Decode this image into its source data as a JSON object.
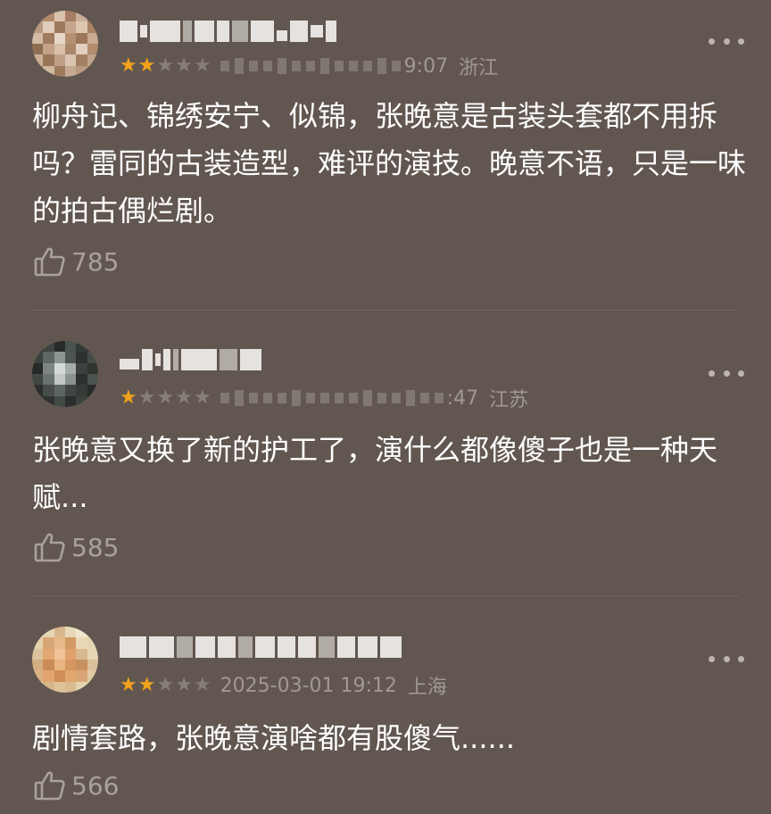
{
  "comments": [
    {
      "rating": 2,
      "time": "9:07",
      "location": "浙江",
      "text": "柳舟记、锦绣安宁、似锦，张晚意是古装头套都不用拆吗？雷同的古装造型，难评的演技。晚意不语，只是一味的拍古偶烂剧。",
      "likes": "785"
    },
    {
      "rating": 1,
      "time": ":47",
      "location": "江苏",
      "text": "张晚意又换了新的护工了，演什么都像傻子也是一种天赋...",
      "likes": "585"
    },
    {
      "rating": 2,
      "time": "2025-03-01 19:12",
      "location": "上海",
      "text": "剧情套路，张晚意演啥都有股傻气......",
      "likes": "566"
    }
  ],
  "icons": {
    "more": "more-dots-icon",
    "like": "thumbs-up-icon",
    "star": "star-icon"
  },
  "colors": {
    "background": "#615750",
    "star_on": "#f4a21d",
    "star_off": "#887e78",
    "meta_text": "#a29893"
  }
}
